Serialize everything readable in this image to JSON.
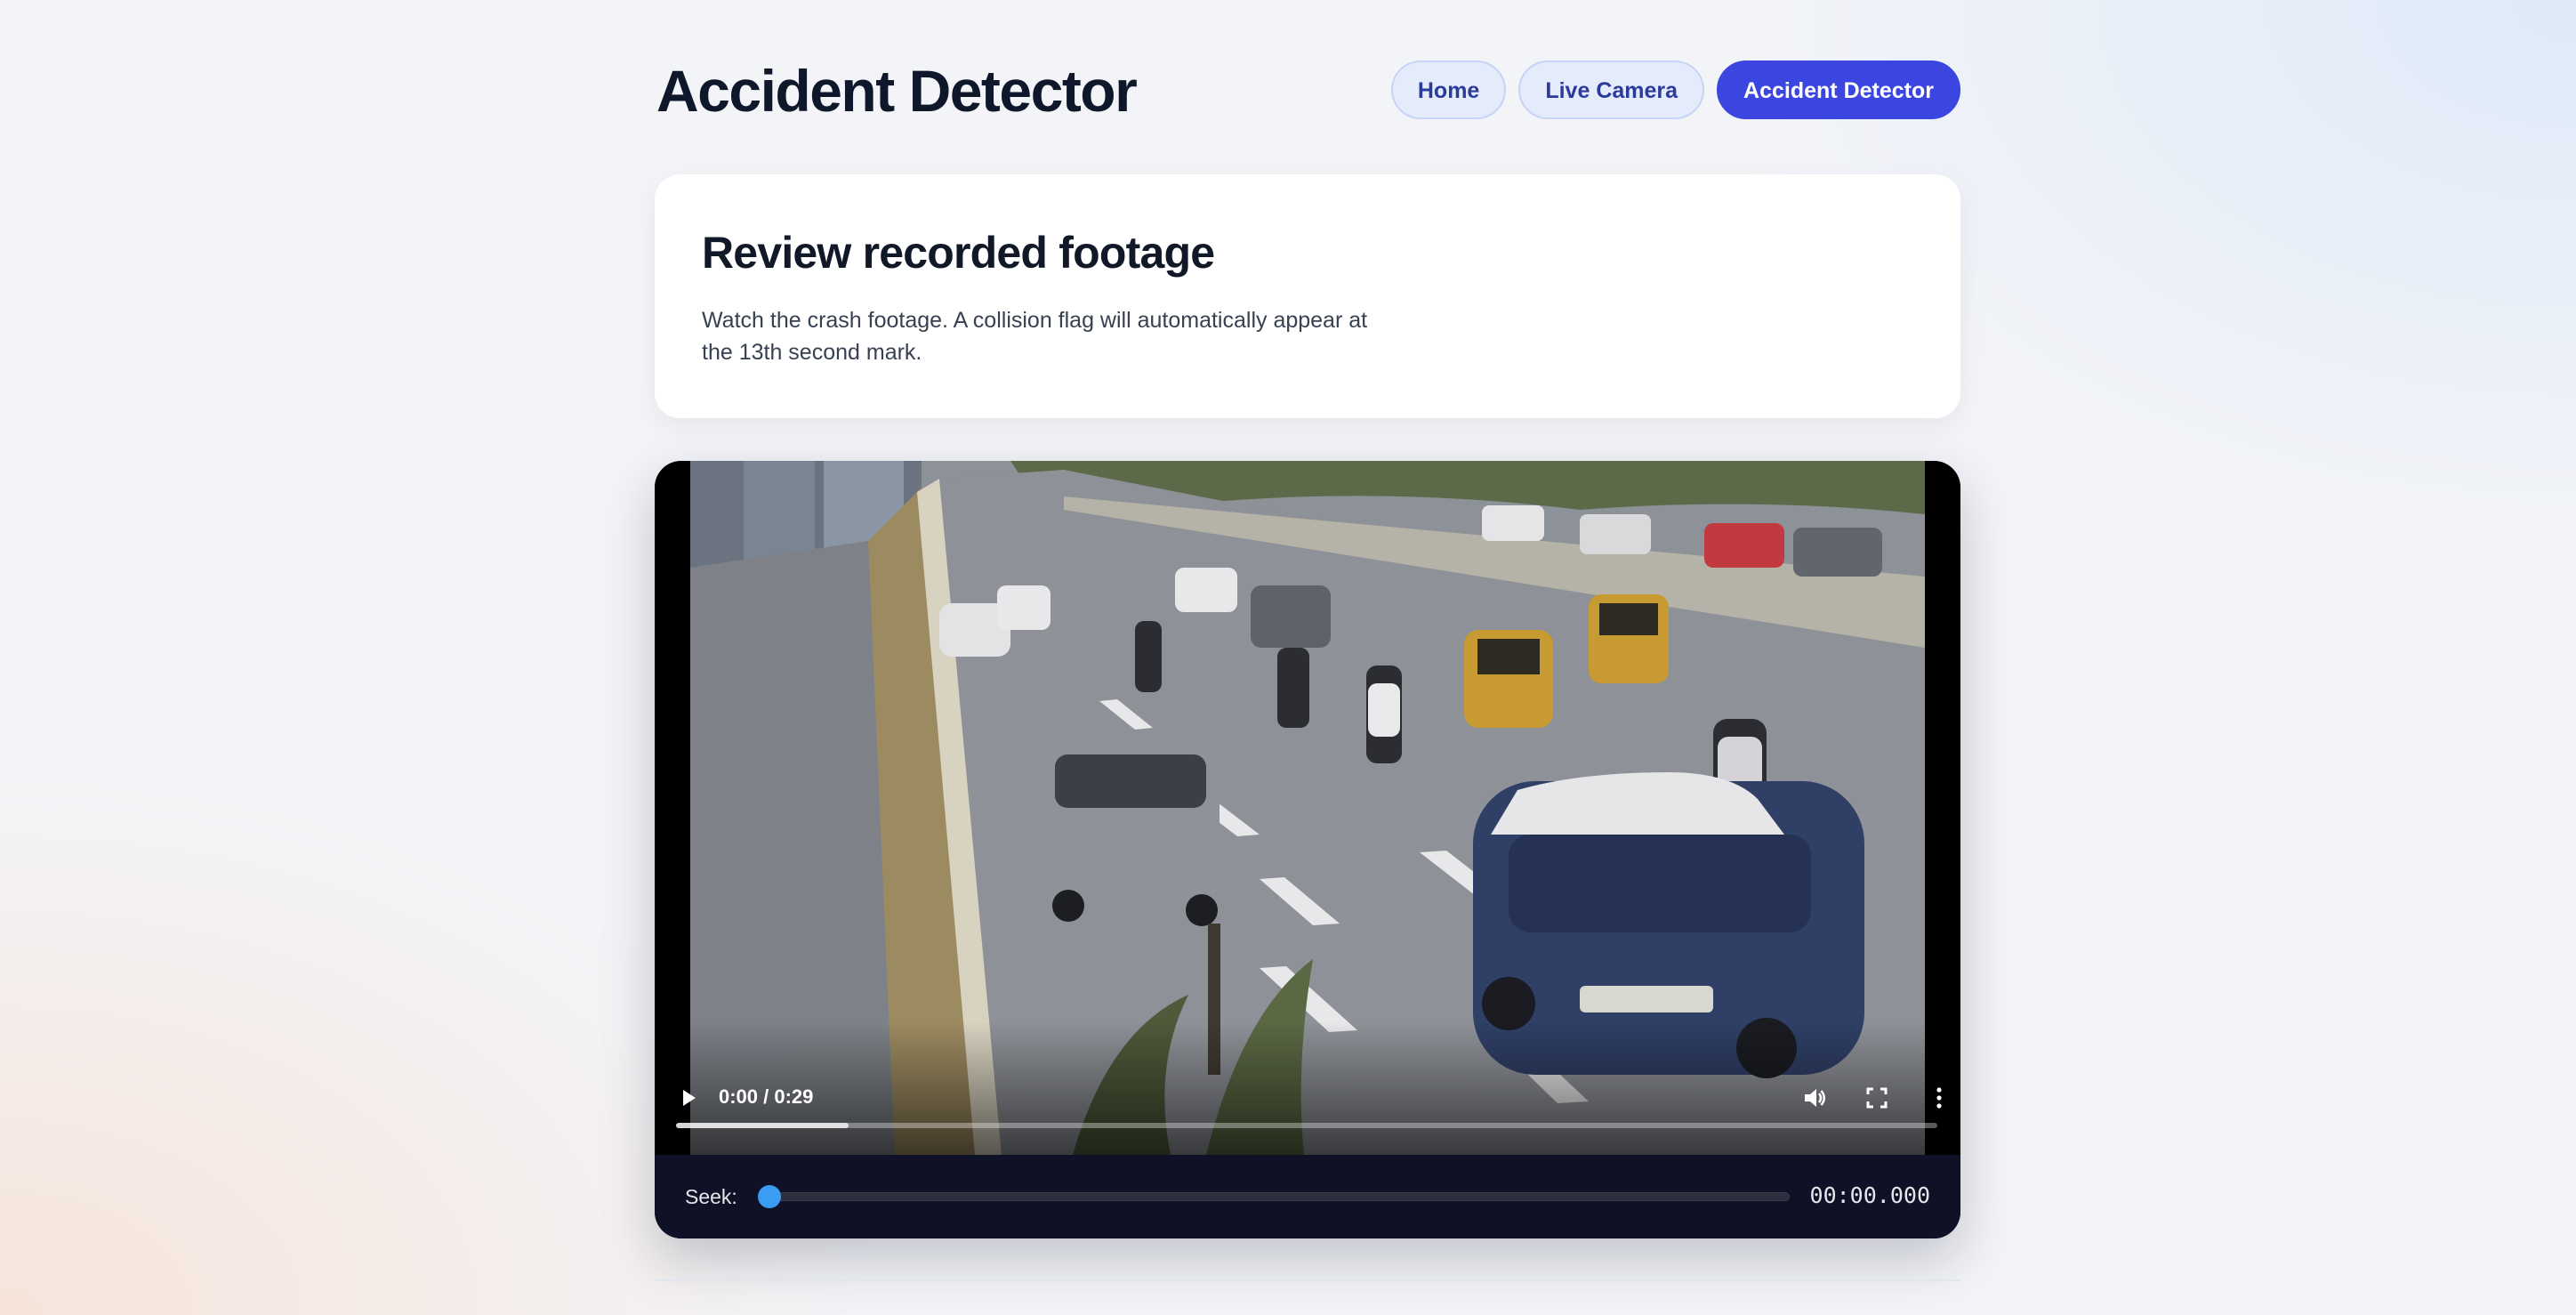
{
  "header": {
    "title": "Accident Detector",
    "nav": [
      {
        "label": "Home",
        "active": false
      },
      {
        "label": "Live Camera",
        "active": false
      },
      {
        "label": "Accident Detector",
        "active": true
      }
    ]
  },
  "intro": {
    "heading": "Review recorded footage",
    "description": "Watch the crash footage. A collision flag will automatically appear at the 13th second mark."
  },
  "video": {
    "time_display": "0:00 / 0:29",
    "buffered_fraction": 0.137,
    "controls": {
      "play_icon": "play-icon",
      "volume_icon": "volume-icon",
      "fullscreen_icon": "fullscreen-icon",
      "more_icon": "more-vertical-icon"
    }
  },
  "seek": {
    "label": "Seek:",
    "value_fraction": 0.0,
    "time": "00:00.000"
  },
  "colors": {
    "accent": "#3b46e0",
    "nav_bg": "#e4ebfa",
    "player_bg": "#0f1226",
    "seek_thumb": "#3b9cf3"
  }
}
